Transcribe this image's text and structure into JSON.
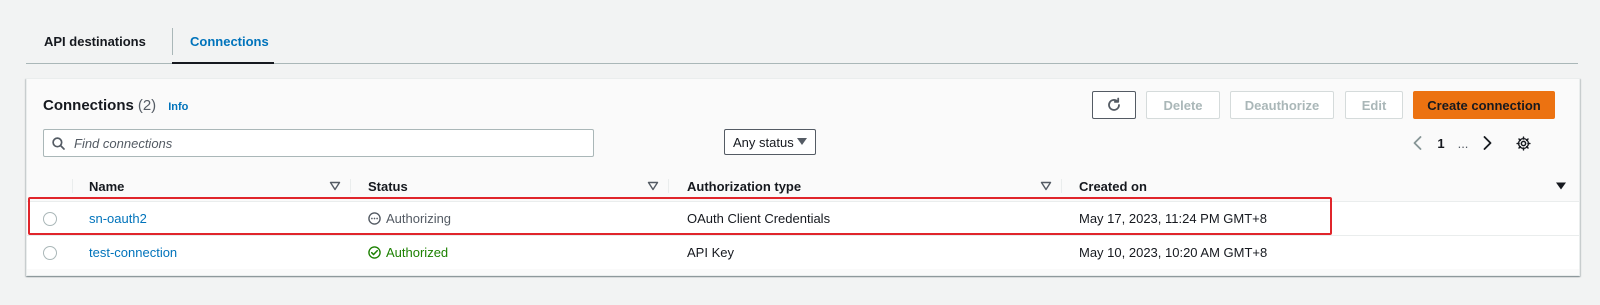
{
  "tabs": [
    {
      "label": "API destinations"
    },
    {
      "label": "Connections"
    }
  ],
  "header": {
    "title": "Connections",
    "count": "(2)",
    "info": "Info"
  },
  "buttons": {
    "delete": "Delete",
    "deauthorize": "Deauthorize",
    "edit": "Edit",
    "create": "Create connection"
  },
  "search": {
    "placeholder": "Find connections"
  },
  "filter": {
    "status": "Any status"
  },
  "pagination": {
    "page": "1",
    "ellipsis": "..."
  },
  "columns": [
    "Name",
    "Status",
    "Authorization type",
    "Created on"
  ],
  "rows": [
    {
      "name": "sn-oauth2",
      "status": "Authorizing",
      "auth_type": "OAuth Client Credentials",
      "created": "May 17, 2023, 11:24 PM GMT+8"
    },
    {
      "name": "test-connection",
      "status": "Authorized",
      "auth_type": "API Key",
      "created": "May 10, 2023, 10:20 AM GMT+8"
    }
  ],
  "colors": {
    "primary": "#ec7211",
    "link": "#0073bb",
    "success": "#1d8102",
    "highlight": "#e0252b"
  }
}
